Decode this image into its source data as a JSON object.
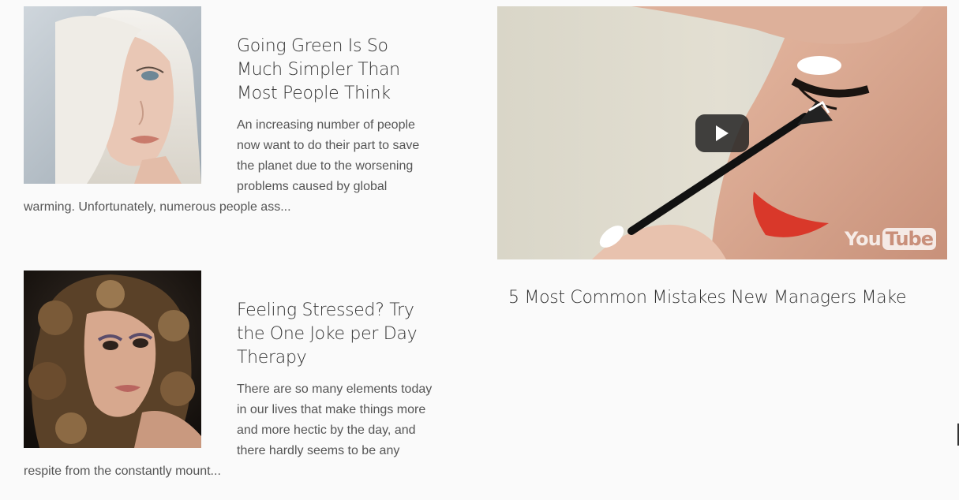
{
  "posts": [
    {
      "title": "Going Green Is So Much Simpler Than Most People Think",
      "excerpt": "An increasing number of people now want to do their part to save the planet due to the worsening problems caused by global warming. Unfortunately, numerous people ass...",
      "image": "blonde-woman-portrait"
    },
    {
      "title": "Feeling Stressed? Try the One Joke per Day Therapy",
      "excerpt": "There are so many elements today in our lives that make things more and more hectic by the day, and there hardly seems to be any respite from the constantly mount...",
      "image": "curly-hair-woman-portrait"
    }
  ],
  "video": {
    "title": "5 Most Common Mistakes New Managers Make",
    "provider_logo": {
      "left": "You",
      "right": "Tube"
    },
    "play_icon": "play-icon",
    "colors": {
      "play_bg": "#232323",
      "lip": "#d9382a",
      "skin": "#dba690"
    }
  }
}
